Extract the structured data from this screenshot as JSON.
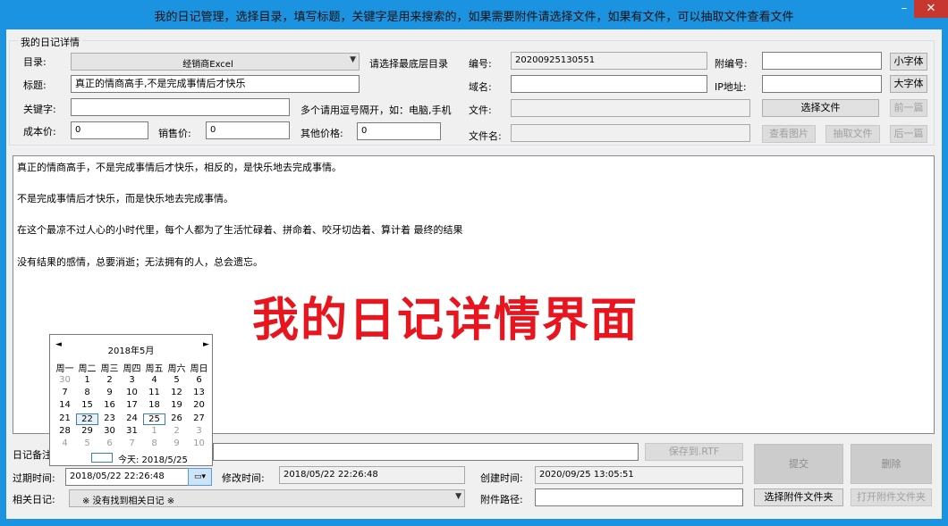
{
  "window": {
    "title": "我的日记管理，选择目录，填写标题，关键字是用来搜索的，如果需要附件请选择文件，如果有文件，可以抽取文件查看文件",
    "minimize": "–",
    "close": "✕"
  },
  "group": {
    "title": "我的日记详情"
  },
  "form": {
    "catalog_label": "目录:",
    "catalog_value": "经销商Excel",
    "catalog_hint": "请选择最底层目录",
    "number_label": "编号:",
    "number_value": "20200925130551",
    "subnumber_label": "附编号:",
    "subnumber_value": "",
    "small_font_button": "小字体",
    "title_label": "标题:",
    "title_value": "真正的情商高手,不是完成事情后才快乐",
    "domain_label": "域名:",
    "domain_value": "",
    "ip_label": "IP地址:",
    "ip_value": "",
    "large_font_button": "大字体",
    "keyword_label": "关键字:",
    "keyword_value": "",
    "keyword_hint": "多个请用逗号隔开，如：电脑,手机",
    "file_label": "文件:",
    "file_value": "",
    "choose_file_button": "选择文件",
    "prev_button": "前一篇",
    "cost_label": "成本价:",
    "cost_value": "0",
    "sale_label": "销售价:",
    "sale_value": "0",
    "other_price_label": "其他价格:",
    "other_price_value": "0",
    "filename_label": "文件名:",
    "filename_value": "",
    "view_image_button": "查看图片",
    "extract_file_button": "抽取文件",
    "next_button": "后一篇"
  },
  "editor": {
    "paragraphs": [
      "真正的情商高手，不是完成事情后才快乐，相反的，是快乐地去完成事情。",
      "不是完成事情后才快乐，而是快乐地去完成事情。",
      "在这个最凉不过人心的小时代里，每个人都为了生活忙碌着、拼命着、咬牙切齿着、算计着 最终的结果",
      "没有结果的感情，总要消逝；无法拥有的人，总会遗忘。"
    ],
    "overlay": "我的日记详情界面"
  },
  "bottom": {
    "note_label": "日记备注",
    "note_value": "",
    "save_rtf_button": "保存到.RTF",
    "submit_button": "提交",
    "delete_button": "删除",
    "expire_label": "过期时间:",
    "expire_value": "2018/05/22 22:26:48",
    "modify_label": "修改时间:",
    "modify_value": "2018/05/22 22:26:48",
    "create_label": "创建时间:",
    "create_value": "2020/09/25 13:05:51",
    "related_label": "相关日记:",
    "related_value": "※ 没有找到相关日记 ※",
    "attach_path_label": "附件路径:",
    "attach_path_value": "",
    "choose_attach_button": "选择附件文件夹",
    "open_attach_button": "打开附件文件夹"
  },
  "calendar": {
    "month_label": "2018年5月",
    "prev_arrow": "◄",
    "next_arrow": "►",
    "weekdays": [
      "周一",
      "周二",
      "周三",
      "周四",
      "周五",
      "周六",
      "周日"
    ],
    "weeks": [
      [
        "30",
        "1",
        "2",
        "3",
        "4",
        "5",
        "6"
      ],
      [
        "7",
        "8",
        "9",
        "10",
        "11",
        "12",
        "13"
      ],
      [
        "14",
        "15",
        "16",
        "17",
        "18",
        "19",
        "20"
      ],
      [
        "21",
        "22",
        "23",
        "24",
        "25",
        "26",
        "27"
      ],
      [
        "28",
        "29",
        "30",
        "31",
        "1",
        "2",
        "3"
      ],
      [
        "4",
        "5",
        "6",
        "7",
        "8",
        "9",
        "10"
      ]
    ],
    "selected_day": "22",
    "today_day": "25",
    "today_label": "今天: 2018/5/25"
  }
}
